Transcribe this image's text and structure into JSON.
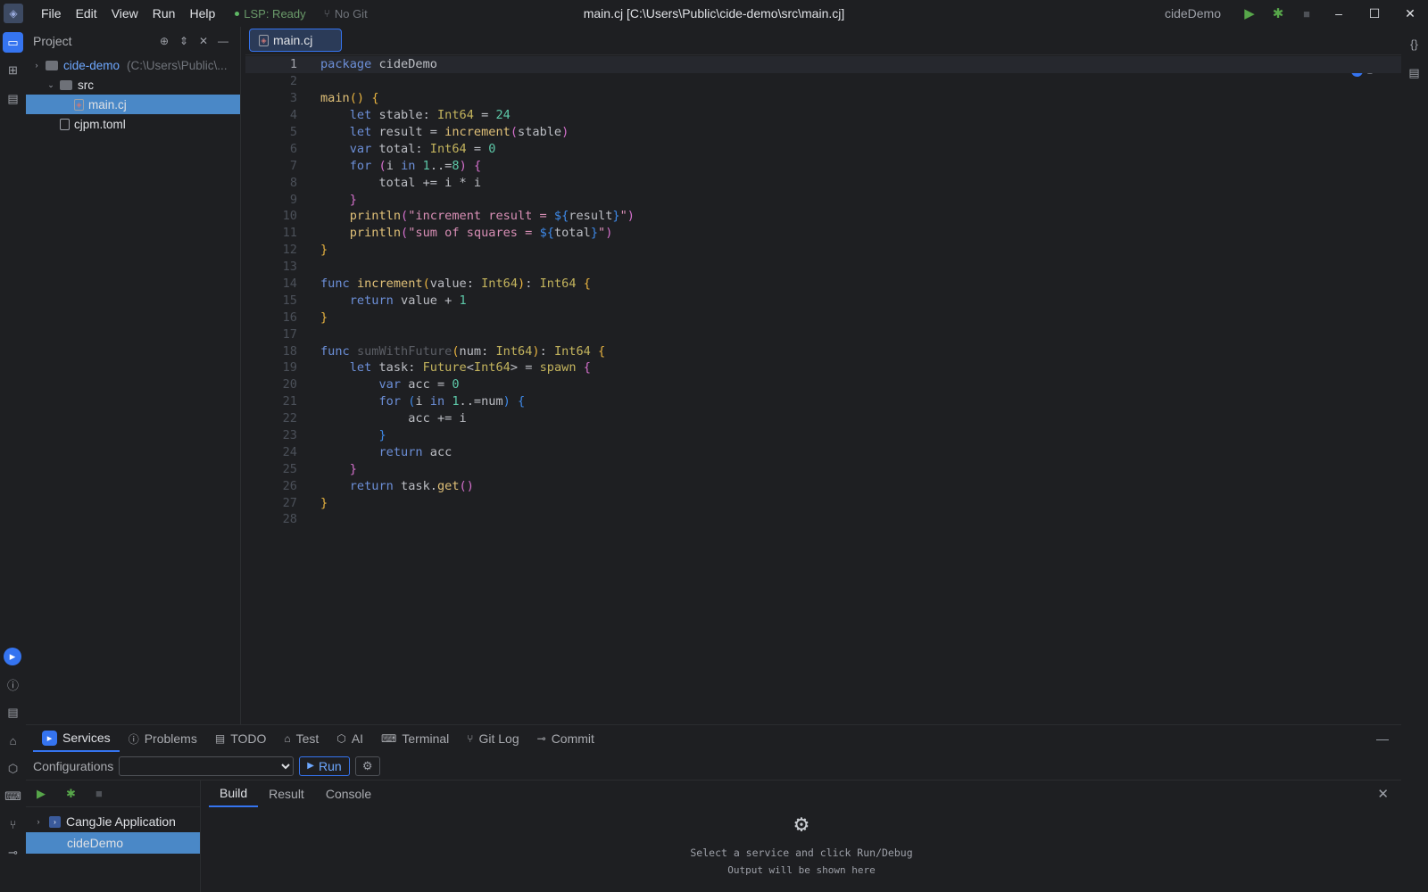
{
  "titlebar": {
    "menus": [
      "File",
      "Edit",
      "View",
      "Run",
      "Help"
    ],
    "lsp_status": "LSP: Ready",
    "git_status": "No Git",
    "window_title": "main.cj [C:\\Users\\Public\\cide-demo\\src\\main.cj]",
    "project_name": "cideDemo"
  },
  "project_panel": {
    "title": "Project",
    "root_name": "cide-demo",
    "root_path": "(C:\\Users\\Public\\...",
    "src_folder": "src",
    "main_file": "main.cj",
    "toml_file": "cjpm.toml"
  },
  "editor": {
    "tab_label": "main.cj",
    "info_count": "1",
    "line_count": 28
  },
  "bottom": {
    "tabs": {
      "services": "Services",
      "problems": "Problems",
      "todo": "TODO",
      "test": "Test",
      "ai": "AI",
      "terminal": "Terminal",
      "gitlog": "Git Log",
      "commit": "Commit"
    },
    "config_label": "Configurations",
    "run_label": "Run",
    "tree": {
      "app": "CangJie Application",
      "item": "cideDemo"
    },
    "output_tabs": {
      "build": "Build",
      "result": "Result",
      "console": "Console"
    },
    "placeholder_line1": "Select a service and click Run/Debug",
    "placeholder_line2": "Output will be shown here"
  },
  "colors": {
    "accent": "#3574f0",
    "selection": "#4a88c7",
    "run_green": "#57a64a"
  }
}
